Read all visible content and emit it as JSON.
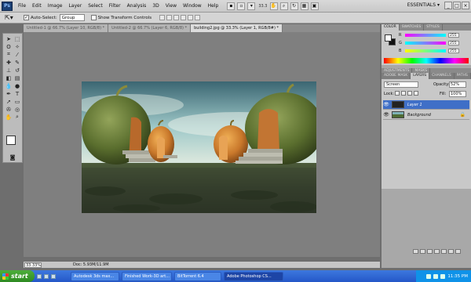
{
  "app": {
    "logo_text": "Ps",
    "zoom_readout": "33.3",
    "workspace": "ESSENTIALS ▾"
  },
  "menu": [
    "File",
    "Edit",
    "Image",
    "Layer",
    "Select",
    "Filter",
    "Analysis",
    "3D",
    "View",
    "Window",
    "Help"
  ],
  "window_controls": [
    "_",
    "□",
    "×"
  ],
  "options": {
    "auto_select_label": "Auto-Select:",
    "auto_select_checked": true,
    "group_value": "Group",
    "transform_label": "Show Transform Controls"
  },
  "tabs": [
    {
      "label": "Untitled-1 @ 66.7% (Layer 10, RGB/8) *",
      "active": false
    },
    {
      "label": "Untitled-2 @ 66.7% (Layer 6, RGB/8) *",
      "active": false
    },
    {
      "label": "building2.jpg @ 33.3% (Layer 1, RGB/8#) *",
      "active": true
    }
  ],
  "status": {
    "zoom": "33.33%",
    "doc": "Doc: 5.93M/11.9M"
  },
  "color_panel": {
    "tabs": [
      "COLOR",
      "SWATCHES",
      "STYLES"
    ],
    "channels": [
      {
        "label": "R",
        "value": "255",
        "gradient": "#ff00ff,#00ffff"
      },
      {
        "label": "G",
        "value": "255",
        "gradient": "#00ffff,#ffff00"
      },
      {
        "label": "B",
        "value": "255",
        "gradient": "#ffff00,#00ffff"
      }
    ]
  },
  "adjust_tabs": [
    "ADJUSTMENTS",
    "MASKS"
  ],
  "layers_panel": {
    "tabs": [
      "ADOBE MASK",
      "LAYERS",
      "CHANNELS",
      "PATHS"
    ],
    "blend_mode": "Screen",
    "opacity_label": "Opacity:",
    "opacity": "52%",
    "lock_label": "Lock:",
    "fill_label": "Fill:",
    "fill": "100%",
    "layers": [
      {
        "name": "Layer 1",
        "selected": true,
        "locked": false
      },
      {
        "name": "Background",
        "selected": false,
        "locked": true
      }
    ]
  },
  "taskbar": {
    "start": "start",
    "tasks": [
      {
        "label": "Autodesk 3ds max...",
        "active": false
      },
      {
        "label": "Finished Work-3D art...",
        "active": false
      },
      {
        "label": "BitTorrent 6.4",
        "active": false
      },
      {
        "label": "Adobe Photoshop CS...",
        "active": true
      }
    ],
    "clock": "11:35 PM"
  },
  "colors": {
    "selection": "#3f6fc7",
    "taskbar": "#2457c8",
    "start": "#2e8a22"
  }
}
